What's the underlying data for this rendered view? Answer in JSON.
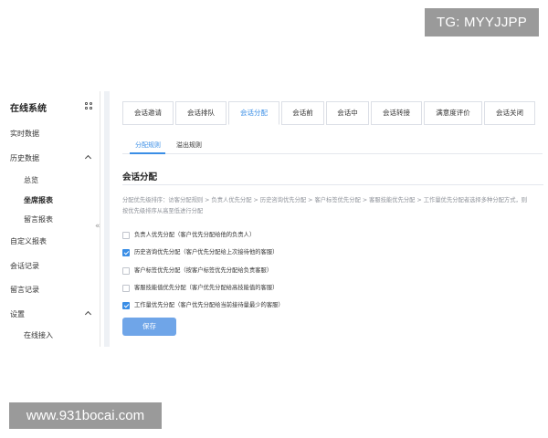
{
  "watermark_top": "TG: MYYJJPP",
  "watermark_bottom": "www.931bocai.com",
  "sidebar": {
    "title": "在线系统",
    "collapse_glyph": "«",
    "items": [
      {
        "label": "实时数据"
      },
      {
        "label": "历史数据"
      },
      {
        "label": "总览"
      },
      {
        "label": "坐席报表"
      },
      {
        "label": "留言报表"
      },
      {
        "label": "自定义报表"
      },
      {
        "label": "会话记录"
      },
      {
        "label": "留言记录"
      },
      {
        "label": "设置"
      },
      {
        "label": "在线接入"
      }
    ]
  },
  "tabs": [
    {
      "label": "会话邀请"
    },
    {
      "label": "会话排队"
    },
    {
      "label": "会话分配"
    },
    {
      "label": "会话前"
    },
    {
      "label": "会话中"
    },
    {
      "label": "会话转接"
    },
    {
      "label": "满意度评价"
    },
    {
      "label": "会话关闭"
    }
  ],
  "active_tab": "会话分配",
  "subtabs": [
    {
      "label": "分配规则"
    },
    {
      "label": "溢出规则"
    }
  ],
  "section_title": "会话分配",
  "description": "分配优先级排序：访客分配规则 > 负责人优先分配 > 历史咨询优先分配 > 客户标签优先分配 > 客服技能优先分配 > 工作量优先分配者选择多种分配方式，则按优先级排序从高至低进行分配",
  "options": [
    {
      "label": "负责人优先分配（客户优先分配给他的负责人）",
      "checked": false
    },
    {
      "label": "历史咨询优先分配（客户优先分配给上次接待他的客服）",
      "checked": true
    },
    {
      "label": "客户标签优先分配（按客户标签优先分配给负责客服）",
      "checked": false
    },
    {
      "label": "客服技能值优先分配（客户优先分配给高技能值的客服）",
      "checked": false
    },
    {
      "label": "工作量优先分配（客户优先分配给当前接待量最少的客服）",
      "checked": true
    }
  ],
  "save_label": "保存",
  "colors": {
    "accent": "#3a8ee6",
    "save_button": "#6fa5e8",
    "content_bg": "#eef1f5",
    "watermark_bg": "#9a9a9a"
  }
}
